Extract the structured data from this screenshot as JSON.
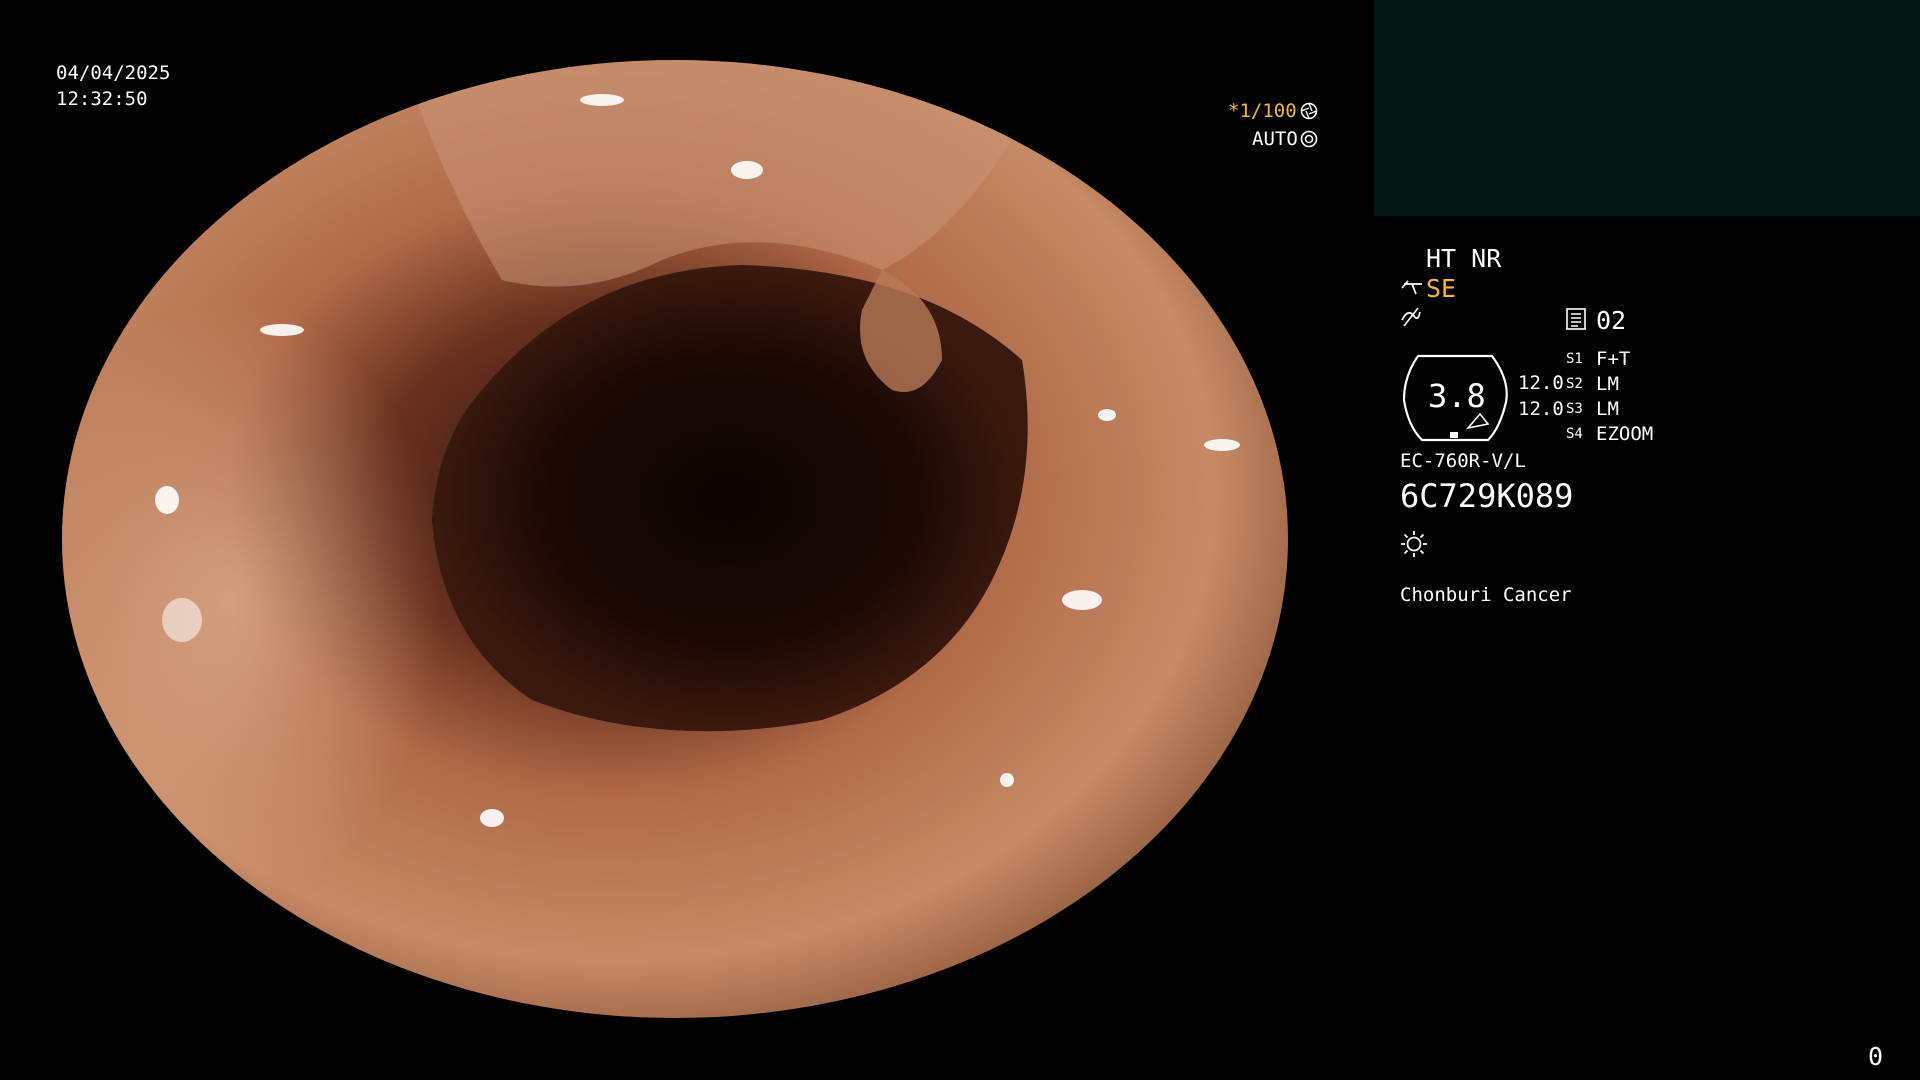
{
  "datetime": {
    "date": "04/04/2025",
    "time": "12:32:50"
  },
  "shutter": {
    "value": "*1/100",
    "mode": "AUTO"
  },
  "settings": {
    "ht_nr": "HT NR",
    "se": "SE",
    "memory_slot": "02",
    "gauge_value": "3.8",
    "gauge_side_values": [
      "12.0",
      "12.0"
    ],
    "switches": [
      {
        "key": "S1",
        "value": "F+T"
      },
      {
        "key": "S2",
        "value": "LM"
      },
      {
        "key": "S3",
        "value": "LM"
      },
      {
        "key": "S4",
        "value": "EZOOM"
      }
    ],
    "scope_model": "EC-760R-V/L",
    "serial": "6C729K089",
    "institution": "Chonburi Cancer"
  },
  "counter": "0",
  "colors": {
    "osd_text": "#ffffff",
    "accent_yellow": "#f2b63c",
    "thumb_panel": "#021510"
  },
  "icons": [
    "aperture-icon",
    "auto-iris-icon",
    "structure-enhance-icon",
    "freeze-icon",
    "memory-icon",
    "light-icon"
  ]
}
